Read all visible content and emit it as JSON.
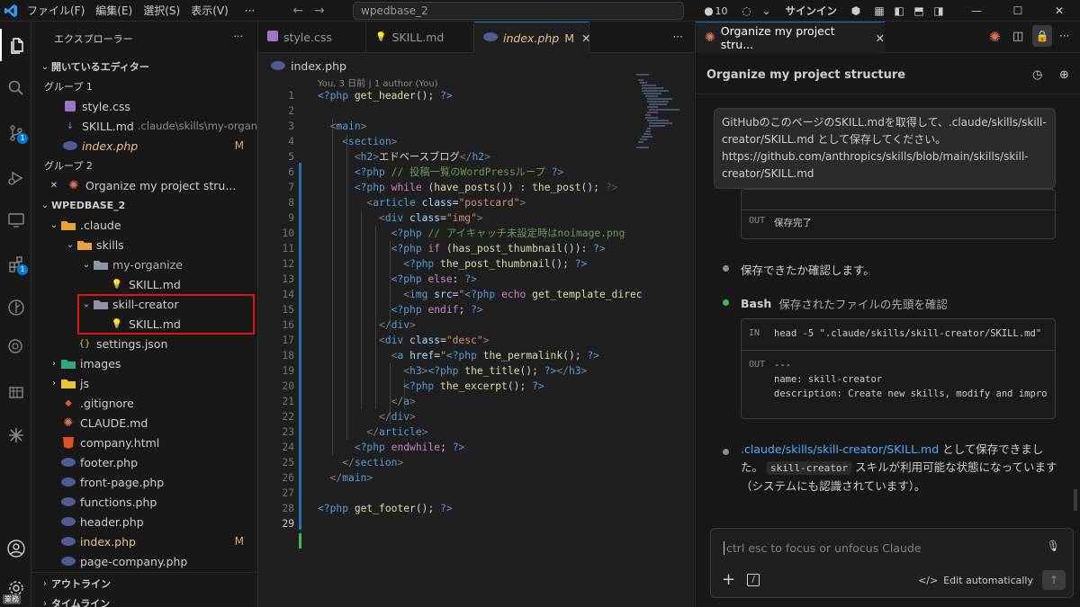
{
  "titlebar": {
    "menus": [
      "ファイル(F)",
      "編集(E)",
      "選択(S)",
      "表示(V)",
      "···"
    ],
    "search": "wpedbase_2",
    "count": "10",
    "signin": "サインイン"
  },
  "activity": {
    "scm_badge": "1",
    "ext_badge": "1",
    "bottom_label": "業務"
  },
  "explorer": {
    "title": "エクスプローラー",
    "open_editors": "開いているエディター",
    "group1": "グループ 1",
    "group2": "グループ 2",
    "open_files": [
      {
        "name": "style.css"
      },
      {
        "name": "SKILL.md",
        "path": ".claude\\skills\\my-organize"
      },
      {
        "name": "index.php",
        "mark": "M"
      }
    ],
    "group2_file": "Organize my project stru...",
    "project": "WPEDBASE_2",
    "tree": {
      "claude": ".claude",
      "skills": "skills",
      "my_organize": "my-organize",
      "skill_md1": "SKILL.md",
      "skill_creator": "skill-creator",
      "skill_md2": "SKILL.md",
      "settings": "settings.json",
      "images": "images",
      "js": "js",
      "gitignore": ".gitignore",
      "claude_md": "CLAUDE.md",
      "company": "company.html",
      "footer": "footer.php",
      "front_page": "front-page.php",
      "functions": "functions.php",
      "header": "header.php",
      "index": "index.php",
      "index_mark": "M",
      "page_company": "page-company.php"
    },
    "outline": "アウトライン",
    "timeline": "タイムライン"
  },
  "editor": {
    "tabs": [
      {
        "label": "style.css"
      },
      {
        "label": "SKILL.md"
      },
      {
        "label": "index.php",
        "mark": "M"
      }
    ],
    "breadcrumb": "index.php",
    "blame": "You, 3 日前 | 1 author (You)",
    "line_numbers": [
      "1",
      "2",
      "3",
      "4",
      "5",
      "6",
      "7",
      "8",
      "9",
      "10",
      "11",
      "12",
      "13",
      "14",
      "15",
      "16",
      "17",
      "18",
      "19",
      "20",
      "21",
      "22",
      "23",
      "24",
      "25",
      "26",
      "27",
      "28",
      "29"
    ]
  },
  "chat": {
    "tab_title": "Organize my project stru...",
    "header": "Organize my project structure",
    "user_message": "GitHubのこのページのSKILL.mdを取得して、.claude/skills/skill-creator/SKILL.md として保存してください。https://github.com/anthropics/skills/blob/main/skills/skill-creator/SKILL.md",
    "out1_label": "OUT",
    "out1_text": "保存完了",
    "step1": "保存できたか確認します。",
    "bash_label": "Bash",
    "bash_desc": "保存されたファイルの先頭を確認",
    "in_label": "IN",
    "in_text": "head -5 \".claude/skills/skill-creator/SKILL.md\"",
    "out2_label": "OUT",
    "out2_lines": [
      "---",
      "name: skill-creator",
      "description: Create new skills, modify and improve exis"
    ],
    "final_link": ".claude/skills/skill-creator/SKILL.md",
    "final_a": " として保存できました。",
    "final_code": "skill-creator",
    "final_b": " スキルが利用可能な状態になっています（システムにも認識されています）。",
    "input_placeholder": "ctrl esc to focus or unfocus Claude",
    "edit_mode": "Edit automatically"
  },
  "colors": {
    "accent": "#0078d4",
    "highlight": "#e01414",
    "modified": "#e2c08d"
  }
}
